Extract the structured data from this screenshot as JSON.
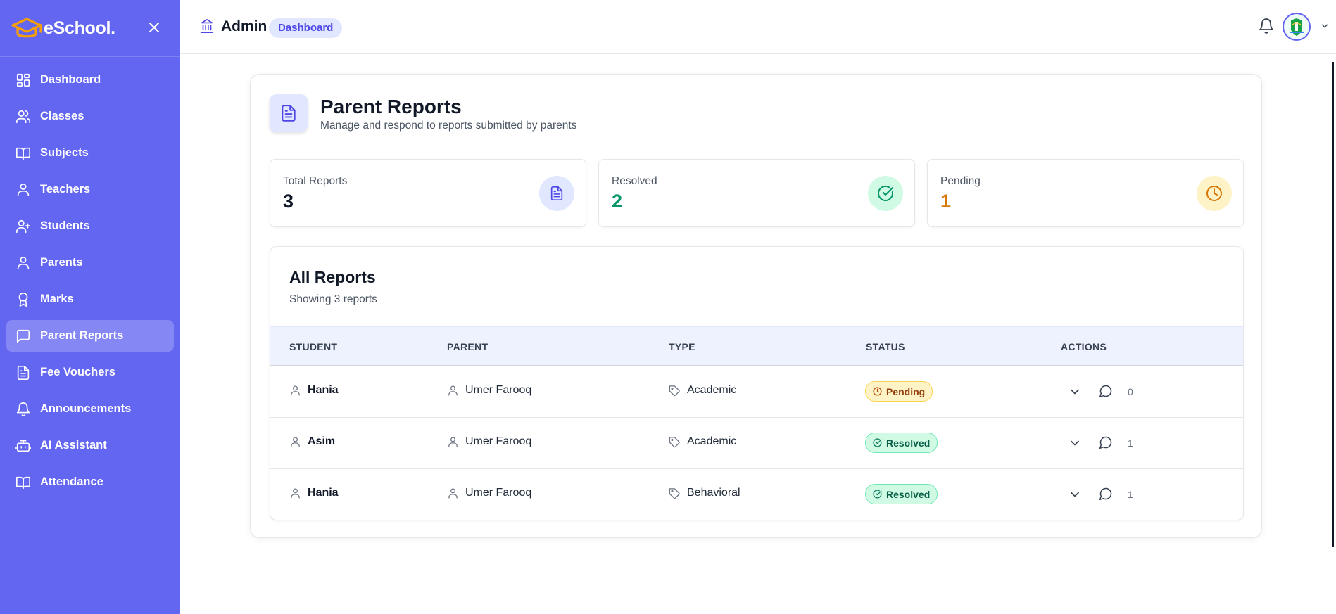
{
  "brand": {
    "name": "eSchool.",
    "logo_icon": "graduation-cap-icon",
    "close_icon": "close-icon"
  },
  "sidebar": {
    "items": [
      {
        "label": "Dashboard",
        "icon": "grid-icon",
        "active": false
      },
      {
        "label": "Classes",
        "icon": "users-icon",
        "active": false
      },
      {
        "label": "Subjects",
        "icon": "book-open-icon",
        "active": false
      },
      {
        "label": "Teachers",
        "icon": "user-icon",
        "active": false
      },
      {
        "label": "Students",
        "icon": "user-plus-icon",
        "active": false
      },
      {
        "label": "Parents",
        "icon": "user-icon",
        "active": false
      },
      {
        "label": "Marks",
        "icon": "award-icon",
        "active": false
      },
      {
        "label": "Parent Reports",
        "icon": "message-square-icon",
        "active": true
      },
      {
        "label": "Fee Vouchers",
        "icon": "file-text-icon",
        "active": false
      },
      {
        "label": "Announcements",
        "icon": "bell-icon",
        "active": false
      },
      {
        "label": "AI Assistant",
        "icon": "bot-icon",
        "active": false
      },
      {
        "label": "Attendance",
        "icon": "book-open-icon",
        "active": false
      }
    ]
  },
  "header": {
    "title": "Admin",
    "breadcrumb": "Dashboard",
    "icon": "bank-icon",
    "bell_icon": "bell-icon",
    "avatar_icon": "avatar-logo"
  },
  "page": {
    "title": "Parent Reports",
    "subtitle": "Manage and respond to reports submitted by parents",
    "icon": "file-text-icon"
  },
  "stats": [
    {
      "label": "Total Reports",
      "value": "3",
      "color": "#111827",
      "icon": "file-text-icon",
      "icon_bg": "#e0e7ff",
      "icon_color": "#4f46e5"
    },
    {
      "label": "Resolved",
      "value": "2",
      "color": "#059669",
      "icon": "check-circle-icon",
      "icon_bg": "#d1fae5",
      "icon_color": "#059669"
    },
    {
      "label": "Pending",
      "value": "1",
      "color": "#d97706",
      "icon": "clock-icon",
      "icon_bg": "#fef3c7",
      "icon_color": "#d97706"
    }
  ],
  "reports": {
    "title": "All Reports",
    "subtitle": "Showing 3 reports",
    "columns": [
      "STUDENT",
      "PARENT",
      "TYPE",
      "STATUS",
      "ACTIONS"
    ],
    "rows": [
      {
        "student": "Hania",
        "parent": "Umer Farooq",
        "type": "Academic",
        "status": "Pending",
        "status_kind": "pending",
        "comments": "0"
      },
      {
        "student": "Asim",
        "parent": "Umer Farooq",
        "type": "Academic",
        "status": "Resolved",
        "status_kind": "resolved",
        "comments": "1"
      },
      {
        "student": "Hania",
        "parent": "Umer Farooq",
        "type": "Behavioral",
        "status": "Resolved",
        "status_kind": "resolved",
        "comments": "1"
      }
    ]
  },
  "colors": {
    "sidebar": "#6366f1",
    "accent": "#4f46e5",
    "header_bg": "#eef2ff"
  }
}
